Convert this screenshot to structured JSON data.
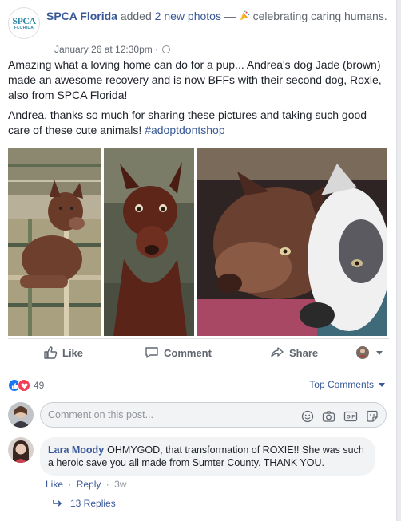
{
  "post": {
    "page_name": "SPCA Florida",
    "action_prefix": "added",
    "action_link": "2 new photos",
    "action_sep": "—",
    "feeling": "celebrating caring humans.",
    "timestamp": "January 26 at 12:30pm",
    "meta_sep": "·",
    "avatar_logo_line1": "SPCA",
    "avatar_logo_line2": "FLORIDA",
    "paragraph1": "Amazing what a loving home can do for a pup... Andrea's dog Jade (brown) made an awesome recovery and is now BFFs with their second dog, Roxie, also from SPCA Florida!",
    "paragraph2_text": "Andrea, thanks so much for sharing these pictures and taking such good care of these cute animals! ",
    "paragraph2_tag": "#adoptdontshop"
  },
  "actions": {
    "like": "Like",
    "comment": "Comment",
    "share": "Share"
  },
  "reactions": {
    "count": "49",
    "top_comments": "Top Comments"
  },
  "composer": {
    "placeholder": "Comment on this post..."
  },
  "comment": {
    "author": "Lara Moody",
    "text": "OHMYGOD, that transformation of ROXIE!! She was such a heroic save you all made from Sumter County. THANK YOU.",
    "like": "Like",
    "reply": "Reply",
    "sep": "·",
    "time": "3w",
    "replies": "13 Replies"
  },
  "colors": {
    "link": "#385898",
    "like_blue": "#1877f2",
    "love_red": "#f33e58"
  },
  "icons": [
    "globe-icon",
    "party-popper-icon",
    "thumbs-up-icon",
    "comment-icon",
    "share-icon",
    "like-reaction-icon",
    "love-reaction-icon",
    "emoji-icon",
    "camera-icon",
    "gif-icon",
    "sticker-icon",
    "reply-arrow-icon"
  ]
}
